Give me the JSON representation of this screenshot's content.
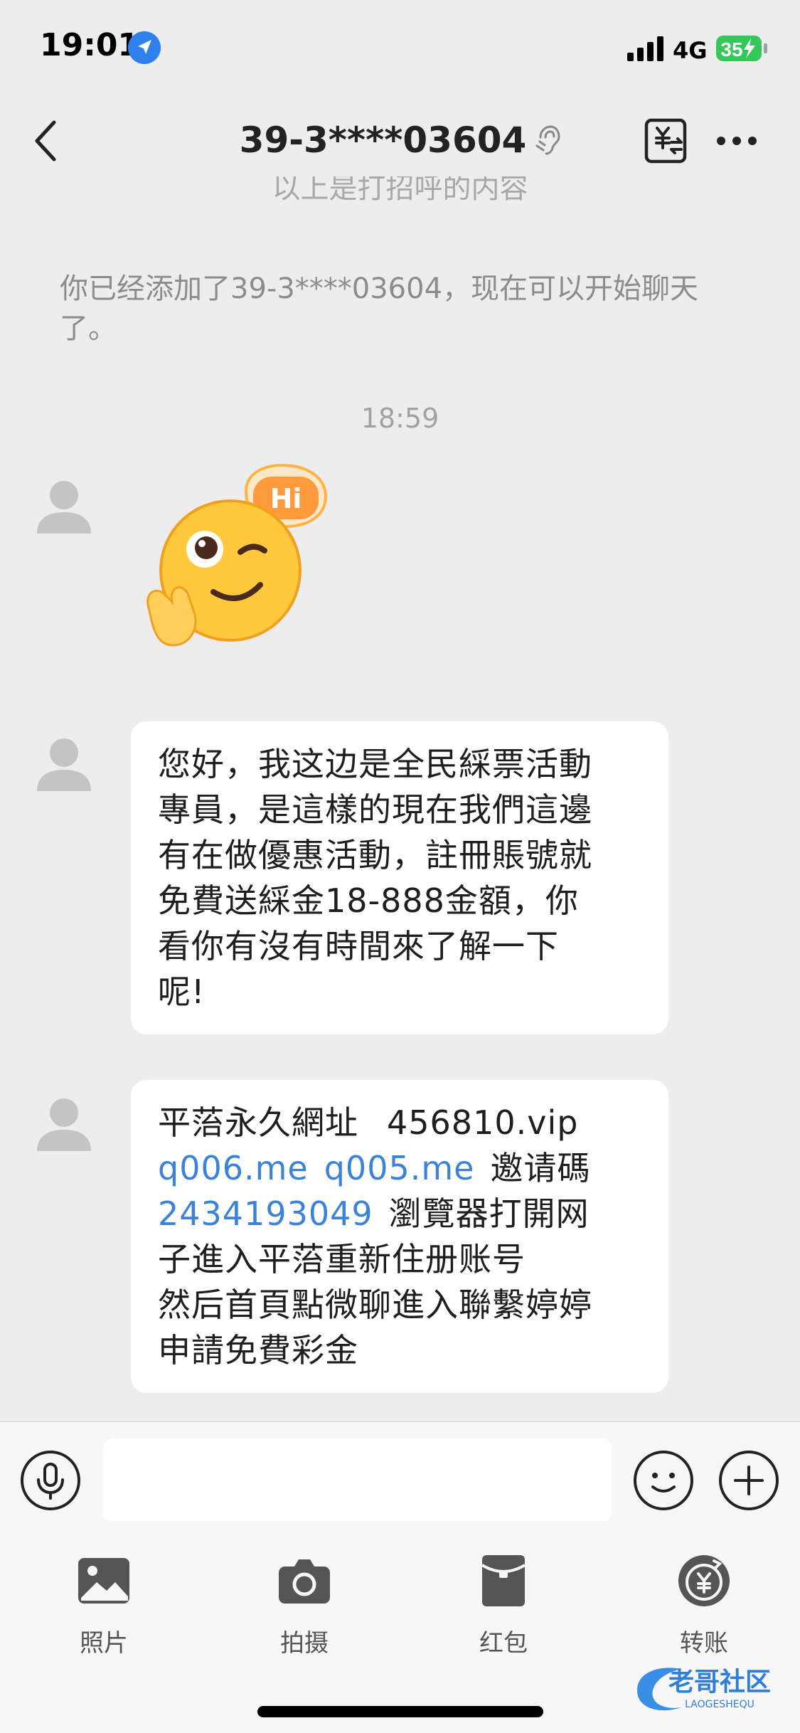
{
  "status_bar": {
    "time": "19:01",
    "network": "4G",
    "battery": "35",
    "icons": [
      "location-arrow-icon",
      "signal-bars-icon",
      "battery-charging-icon"
    ]
  },
  "nav": {
    "title": "39-3****03604",
    "icons": [
      "back-chevron-icon",
      "ear-icon",
      "yuan-transfer-icon",
      "more-dots-icon"
    ]
  },
  "chat": {
    "clipped_text": "以上是打招呼的内容",
    "system_note": "你已经添加了39-3****03604，现在可以开始聊天了。",
    "timestamp": "18:59",
    "message_1": {
      "line_1": "您好，我这边是全民綵票活動",
      "line_2": "專員，是這樣的現在我們這邊",
      "line_3": "有在做優惠活動，註冊賬號就",
      "line_4": "免費送綵金18-888金額，你",
      "line_5": "看你有沒有時間來了解一下",
      "line_6": "呢!"
    },
    "message_2": {
      "line_1_text": "平菭永久網址",
      "line_1_value": "456810.vip",
      "link_1": "q006.me",
      "link_2": "q005.me",
      "invite_label": "邀请碼",
      "invite_code": "2434193049",
      "line_3_text": "瀏覽器打開网",
      "line_4": "子進入平菭重新住册账号",
      "line_5": "然后首頁點微聊進入聯繫婷婷",
      "line_6": "申請免費彩金"
    }
  },
  "input_bar": {
    "icons": [
      "microphone-icon",
      "smiley-icon",
      "plus-icon"
    ]
  },
  "panel": {
    "photos_label": "照片",
    "camera_label": "拍摄",
    "red_packet_label": "红包",
    "transfer_label": "转账"
  },
  "colors": {
    "background": "#ededed",
    "bubble": "#ffffff",
    "link": "#3b82d8",
    "battery_green": "#34c759"
  },
  "watermark": {
    "text": "老哥社区",
    "sub_text": "LAOGESHEQU"
  }
}
